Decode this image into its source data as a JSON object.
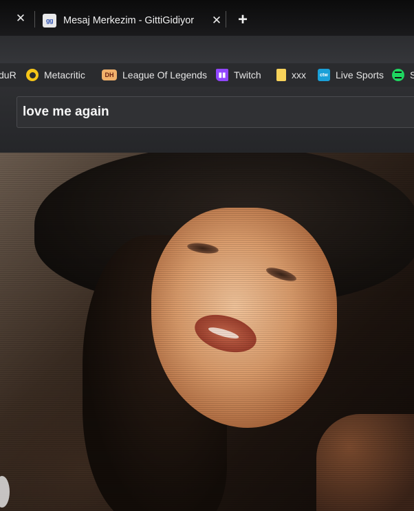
{
  "tabs": {
    "previous_close_icon": "close-icon",
    "active": {
      "favicon_text": "gg",
      "title": "Mesaj Merkezim - GittiGidiyor",
      "close_icon": "close-icon"
    },
    "new_tab_icon": "plus-icon"
  },
  "bookmarks": [
    {
      "label": "duR",
      "icon": "none"
    },
    {
      "label": "Metacritic",
      "icon": "metacritic-icon"
    },
    {
      "label": "League Of Legends",
      "icon": "dh-icon",
      "icon_text": "DH"
    },
    {
      "label": "Twitch",
      "icon": "twitch-icon"
    },
    {
      "label": "xxx",
      "icon": "document-icon"
    },
    {
      "label": "Live Sports",
      "icon": "live-sports-icon",
      "icon_text": "ctw"
    },
    {
      "label": "S",
      "icon": "spotify-icon"
    }
  ],
  "search": {
    "value": "love me again"
  },
  "colors": {
    "tab_strip": "#111113",
    "bookmark_bar": "#2a2b2e",
    "search_box": "#303134",
    "twitch": "#9146ff",
    "spotify": "#1ed760",
    "metacritic": "#f5c518"
  }
}
